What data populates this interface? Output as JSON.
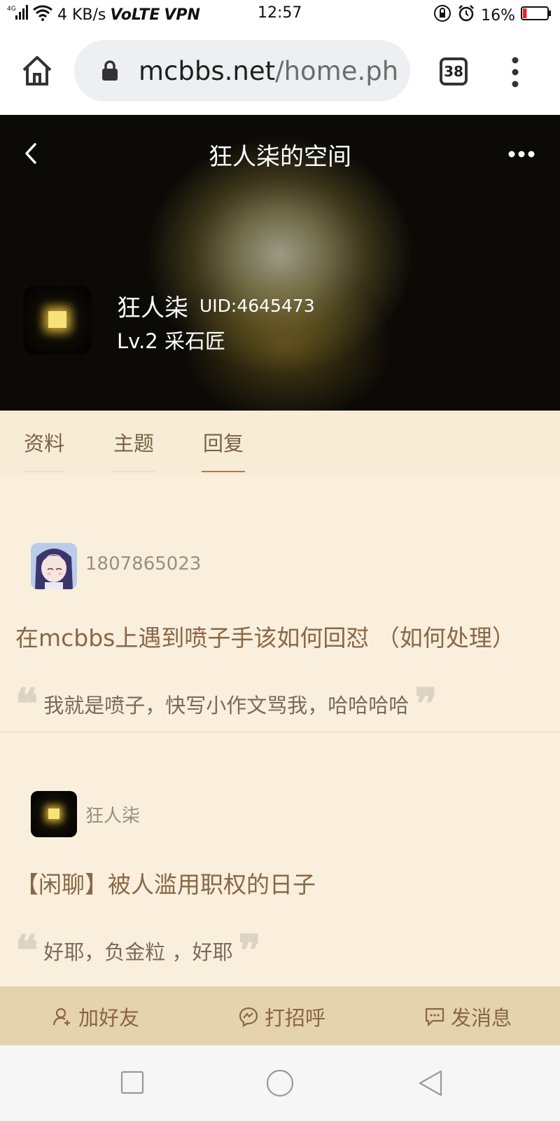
{
  "status_bar": {
    "network": "4G",
    "speed": "4 KB/s",
    "volte": "VoLTE",
    "vpn": "VPN",
    "time": "12:57",
    "battery": "16%",
    "battery_level": 0.16
  },
  "browser": {
    "url_domain": "mcbbs.net",
    "url_rest": "/home.ph",
    "tab_count": "38"
  },
  "header": {
    "title": "狂人柒的空间",
    "username": "狂人柒",
    "uid": "UID:4645473",
    "level": "Lv.2 采石匠"
  },
  "tabs": [
    {
      "label": "资料",
      "active": false
    },
    {
      "label": "主题",
      "active": false
    },
    {
      "label": "回复",
      "active": true
    }
  ],
  "posts": [
    {
      "author": "1807865023",
      "title": "在mcbbs上遇到喷子手该如何回怼 （如何处理）",
      "quote": "我就是喷子，快写小作文骂我，哈哈哈哈"
    },
    {
      "author": "狂人柒",
      "title": "【闲聊】被人滥用职权的日子",
      "quote": "好耶，负金粒 ，好耶"
    }
  ],
  "actions": {
    "add_friend": "加好友",
    "greet": "打招呼",
    "message": "发消息"
  },
  "colors": {
    "accent": "#a57f55",
    "tab_text": "#7a6245",
    "content_bg": "#f9efdc",
    "action_bg": "#e5d3b0"
  }
}
